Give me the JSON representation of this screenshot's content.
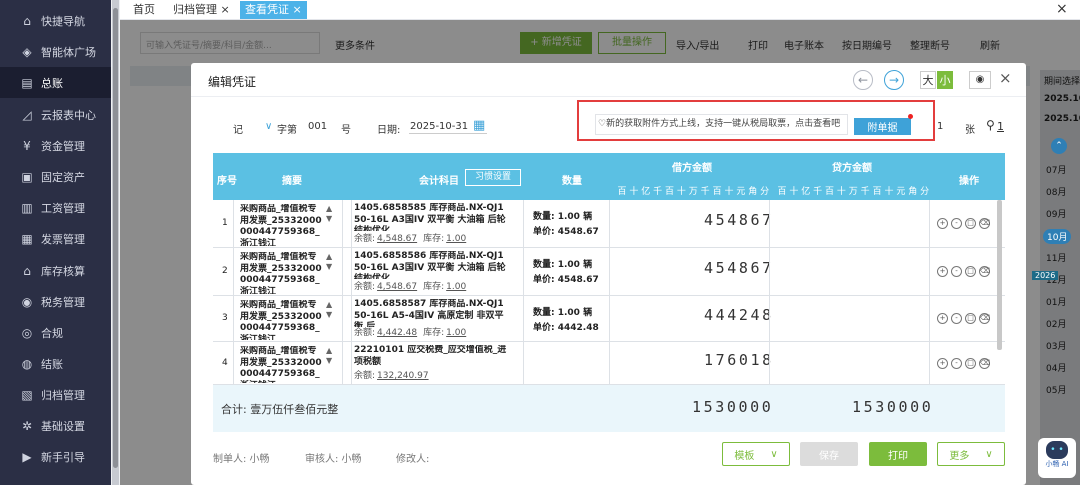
{
  "sidebar": {
    "items": [
      {
        "label": "快捷导航",
        "icon": "home-icon",
        "glyph": "⌂"
      },
      {
        "label": "智能体广场",
        "icon": "grad-cap-icon",
        "glyph": "◈"
      },
      {
        "label": "总账",
        "icon": "ledger-icon",
        "glyph": "▤",
        "active": true
      },
      {
        "label": "云报表中心",
        "icon": "chart-icon",
        "glyph": "◿"
      },
      {
        "label": "资金管理",
        "icon": "money-icon",
        "glyph": "¥"
      },
      {
        "label": "固定资产",
        "icon": "asset-icon",
        "glyph": "▣"
      },
      {
        "label": "工资管理",
        "icon": "salary-icon",
        "glyph": "▥"
      },
      {
        "label": "发票管理",
        "icon": "invoice-icon",
        "glyph": "▦"
      },
      {
        "label": "库存核算",
        "icon": "warehouse-icon",
        "glyph": "⌂"
      },
      {
        "label": "税务管理",
        "icon": "tax-icon",
        "glyph": "◉"
      },
      {
        "label": "合规",
        "icon": "compliance-icon",
        "glyph": "◎"
      },
      {
        "label": "结账",
        "icon": "checkout-icon",
        "glyph": "◍"
      },
      {
        "label": "归档管理",
        "icon": "archive-icon",
        "glyph": "▧"
      },
      {
        "label": "基础设置",
        "icon": "settings-icon",
        "glyph": "✲"
      },
      {
        "label": "新手引导",
        "icon": "guide-icon",
        "glyph": "▶"
      }
    ]
  },
  "tabs": [
    {
      "label": "首页"
    },
    {
      "label": "归档管理 ×"
    },
    {
      "label": "查看凭证 ×"
    }
  ],
  "window_close": "×",
  "modal": {
    "title": "编辑凭证",
    "size_big": "大",
    "size_small": "小",
    "nav_prev": "←",
    "nav_next": "→",
    "eye": "◉",
    "close": "×",
    "voucher_word": "记",
    "word_label": "字第",
    "voucher_no": "001",
    "no_label": "号",
    "date_label": "日期:",
    "date": "2025-10-31",
    "attach_count": "1",
    "attach_unit": "张",
    "clip_count": "1",
    "notice_text": "♡新的获取附件方式上线，支持一键从税局取票，点击查看吧",
    "notice_button": "附单据"
  },
  "table": {
    "headers": {
      "seq": "序号",
      "summary": "摘要",
      "account": "会计科目",
      "account_btn": "习惯设置",
      "qty": "数量",
      "debit": "借方金额",
      "credit": "贷方金额",
      "ops": "操作"
    },
    "digits": [
      "百",
      "十",
      "亿",
      "千",
      "百",
      "十",
      "万",
      "千",
      "百",
      "十",
      "元",
      "角",
      "分"
    ],
    "rows": [
      {
        "no": "1",
        "summary": "采购商品_增值税专用发票_25332000000447759368_浙江钱江",
        "account": "1405.6858585 库存商品.NX-QJ150-16L A3国IV 双平衡 大油箱 后轮结构优化",
        "balance_label": "余额:",
        "balance": "4,548.67",
        "stock_label": "库存:",
        "stock": "1.00",
        "qty_line": "数量: 1.00 辆",
        "price_line": "单价: 4548.67",
        "debit": "454867",
        "credit": ""
      },
      {
        "no": "2",
        "summary": "采购商品_增值税专用发票_25332000000447759368_浙江钱江",
        "account": "1405.6858586 库存商品.NX-QJ150-16L A3国IV 双平衡 大油箱 后轮结构优化",
        "balance_label": "余额:",
        "balance": "4,548.67",
        "stock_label": "库存:",
        "stock": "1.00",
        "qty_line": "数量: 1.00 辆",
        "price_line": "单价: 4548.67",
        "debit": "454867",
        "credit": ""
      },
      {
        "no": "3",
        "summary": "采购商品_增值税专用发票_25332000000447759368_浙江钱江",
        "account": "1405.6858587 库存商品.NX-QJ150-16L A5-4国IV 高原定制 非双平衡 后",
        "balance_label": "余额:",
        "balance": "4,442.48",
        "stock_label": "库存:",
        "stock": "1.00",
        "qty_line": "数量: 1.00 辆",
        "price_line": "单价: 4442.48",
        "debit": "444248",
        "credit": ""
      },
      {
        "no": "4",
        "summary": "采购商品_增值税专用发票_25332000000447759368_浙江钱江",
        "account": "22210101 应交税费_应交增值税_进项税额",
        "balance_label": "余额:",
        "balance": "132,240.97",
        "stock_label": "",
        "stock": "",
        "qty_line": "",
        "price_line": "",
        "debit": "176018",
        "credit": ""
      }
    ],
    "total_label": "合计: 壹万伍仟叁佰元整",
    "total_debit": "1530000",
    "total_credit": "1530000"
  },
  "footer": {
    "maker": "制单人: 小畅",
    "reviewer": "审核人: 小畅",
    "modifier": "修改人:",
    "template": "模板",
    "save": "保存",
    "print": "打印",
    "more": "更多"
  },
  "bg": {
    "search_placeholder": "可输入凭证号/摘要/科目/金额...",
    "more_conditions": "更多条件",
    "new_voucher": "+ 新增凭证",
    "batch": "批量操作",
    "import_export": "导入/导出",
    "print": "打印",
    "ebook": "电子账本",
    "by_date": "按日期编号",
    "sort": "整理断号",
    "refresh": "刷新"
  },
  "right_strip": {
    "title": "期间选择",
    "y1": "2025.10",
    "y2": "2025.10",
    "months": [
      "07月",
      "08月",
      "09月",
      "10月",
      "11月",
      "12月",
      "01月",
      "02月",
      "03月",
      "04月",
      "05月"
    ],
    "badge": "2026",
    "assistant": "小畅 AI"
  }
}
